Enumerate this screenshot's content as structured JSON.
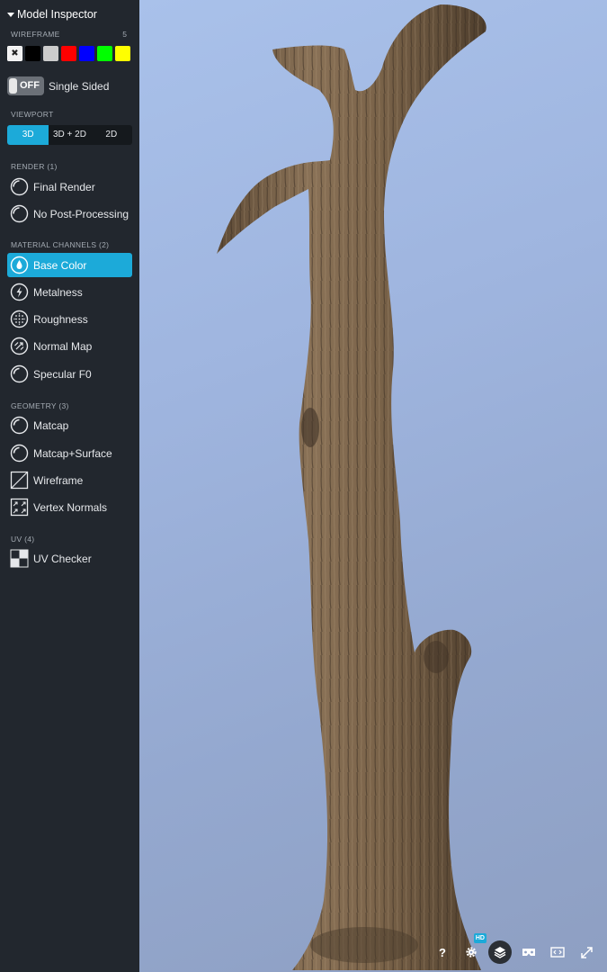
{
  "panel": {
    "title": "Model Inspector"
  },
  "wireframe": {
    "label": "WIREFRAME",
    "count": "5",
    "swatches": [
      {
        "name": "none",
        "color": "#f2f2f2"
      },
      {
        "name": "black",
        "color": "#000000"
      },
      {
        "name": "light-gray",
        "color": "#cccccc"
      },
      {
        "name": "red",
        "color": "#ff0000"
      },
      {
        "name": "blue",
        "color": "#0000ff"
      },
      {
        "name": "green",
        "color": "#00ff00"
      },
      {
        "name": "yellow",
        "color": "#ffff00"
      }
    ]
  },
  "single_sided": {
    "state": "OFF",
    "label": "Single Sided"
  },
  "viewport": {
    "label": "VIEWPORT",
    "options": [
      "3D",
      "3D + 2D",
      "2D"
    ],
    "selected": "3D"
  },
  "render": {
    "label": "RENDER (1)",
    "items": [
      "Final Render",
      "No Post-Processing"
    ]
  },
  "material": {
    "label": "MATERIAL CHANNELS (2)",
    "items": [
      "Base Color",
      "Metalness",
      "Roughness",
      "Normal Map",
      "Specular F0"
    ],
    "selected": "Base Color"
  },
  "geometry": {
    "label": "GEOMETRY (3)",
    "items": [
      "Matcap",
      "Matcap+Surface",
      "Wireframe",
      "Vertex Normals"
    ]
  },
  "uv": {
    "label": "UV (4)",
    "items": [
      "UV Checker"
    ]
  },
  "toolbar": {
    "help": "?",
    "hd_badge": "HD"
  },
  "colors": {
    "accent": "#1caad9",
    "sidebar_bg": "#22272e",
    "viewer_bg": "#a9c1ea"
  }
}
